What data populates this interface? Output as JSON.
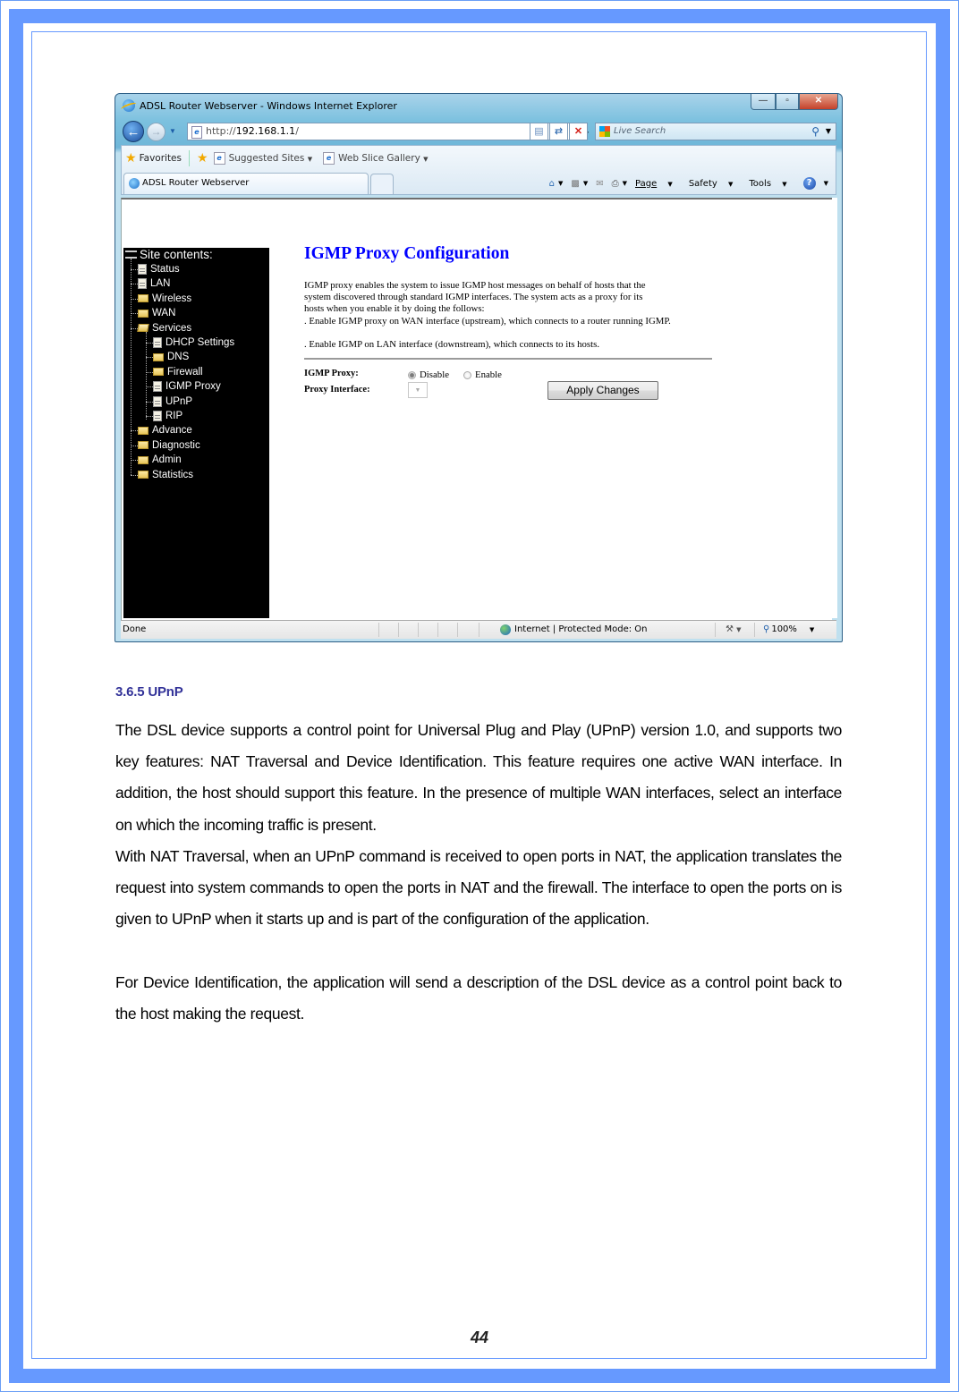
{
  "page": {
    "number": "44",
    "frame_color": "#6699ff"
  },
  "browser": {
    "window_title": "ADSL Router Webserver - Windows Internet Explorer",
    "window_buttons": {
      "minimize": "—",
      "maximize": "▫",
      "close": "✕"
    },
    "address": {
      "scheme": "http://",
      "host": "192.168.1.1",
      "path": "/"
    },
    "search_placeholder": "Live Search",
    "favorites_bar": {
      "favorites_label": "Favorites",
      "links": [
        "Suggested Sites",
        "Web Slice Gallery"
      ]
    },
    "tab_title": "ADSL Router Webserver",
    "command_bar": {
      "page_label": "Page",
      "safety_label": "Safety",
      "tools_label": "Tools"
    },
    "status_bar": {
      "status": "Done",
      "zone": "Internet | Protected Mode: On",
      "zoom": "100%"
    }
  },
  "site_tree": {
    "header": "Site contents:",
    "items": [
      {
        "label": "Status",
        "type": "page",
        "level": 1
      },
      {
        "label": "LAN",
        "type": "page",
        "level": 1
      },
      {
        "label": "Wireless",
        "type": "folder",
        "level": 1
      },
      {
        "label": "WAN",
        "type": "folder",
        "level": 1
      },
      {
        "label": "Services",
        "type": "folder-open",
        "level": 1
      },
      {
        "label": "DHCP Settings",
        "type": "page",
        "level": 2
      },
      {
        "label": "DNS",
        "type": "folder",
        "level": 2
      },
      {
        "label": "Firewall",
        "type": "folder",
        "level": 2
      },
      {
        "label": "IGMP Proxy",
        "type": "page",
        "level": 2
      },
      {
        "label": "UPnP",
        "type": "page",
        "level": 2
      },
      {
        "label": "RIP",
        "type": "page",
        "level": 2
      },
      {
        "label": "Advance",
        "type": "folder",
        "level": 1
      },
      {
        "label": "Diagnostic",
        "type": "folder",
        "level": 1
      },
      {
        "label": "Admin",
        "type": "folder",
        "level": 1
      },
      {
        "label": "Statistics",
        "type": "folder",
        "level": 1
      }
    ]
  },
  "igmp_page": {
    "title": "IGMP Proxy Configuration",
    "description_lines": [
      "IGMP proxy enables the system to issue IGMP host messages on behalf of hosts that the",
      "system discovered through standard IGMP interfaces. The system acts as a proxy for its",
      "hosts when you enable it by doing the follows:",
      ". Enable IGMP proxy on WAN interface (upstream), which connects to a router running IGMP."
    ],
    "description_extra": ". Enable IGMP on LAN interface (downstream), which connects to its hosts.",
    "igmp_proxy_label": "IGMP Proxy:",
    "options": [
      "Disable",
      "Enable"
    ],
    "selected_option": "Disable",
    "proxy_interface_label": "Proxy Interface:",
    "proxy_interface_value": "",
    "apply_button": "Apply Changes"
  },
  "section": {
    "heading": "3.6.5 UPnP",
    "paragraphs": [
      "The DSL device supports a control point for Universal Plug and Play (UPnP) version 1.0, and supports two key features: NAT Traversal and Device Identification. This feature requires one active WAN interface. In addition, the host should support this feature. In the presence of multiple WAN interfaces, select an interface on which the incoming traffic is present.",
      "With NAT Traversal, when an UPnP command is received to open ports in NAT, the application translates the request into system commands to open the ports in NAT and the firewall. The interface to open the ports on is given to UPnP when it starts up and is part of the configuration of the application.",
      "For Device Identification, the application will send a description of the DSL device as a control point back to the host making the request."
    ]
  }
}
